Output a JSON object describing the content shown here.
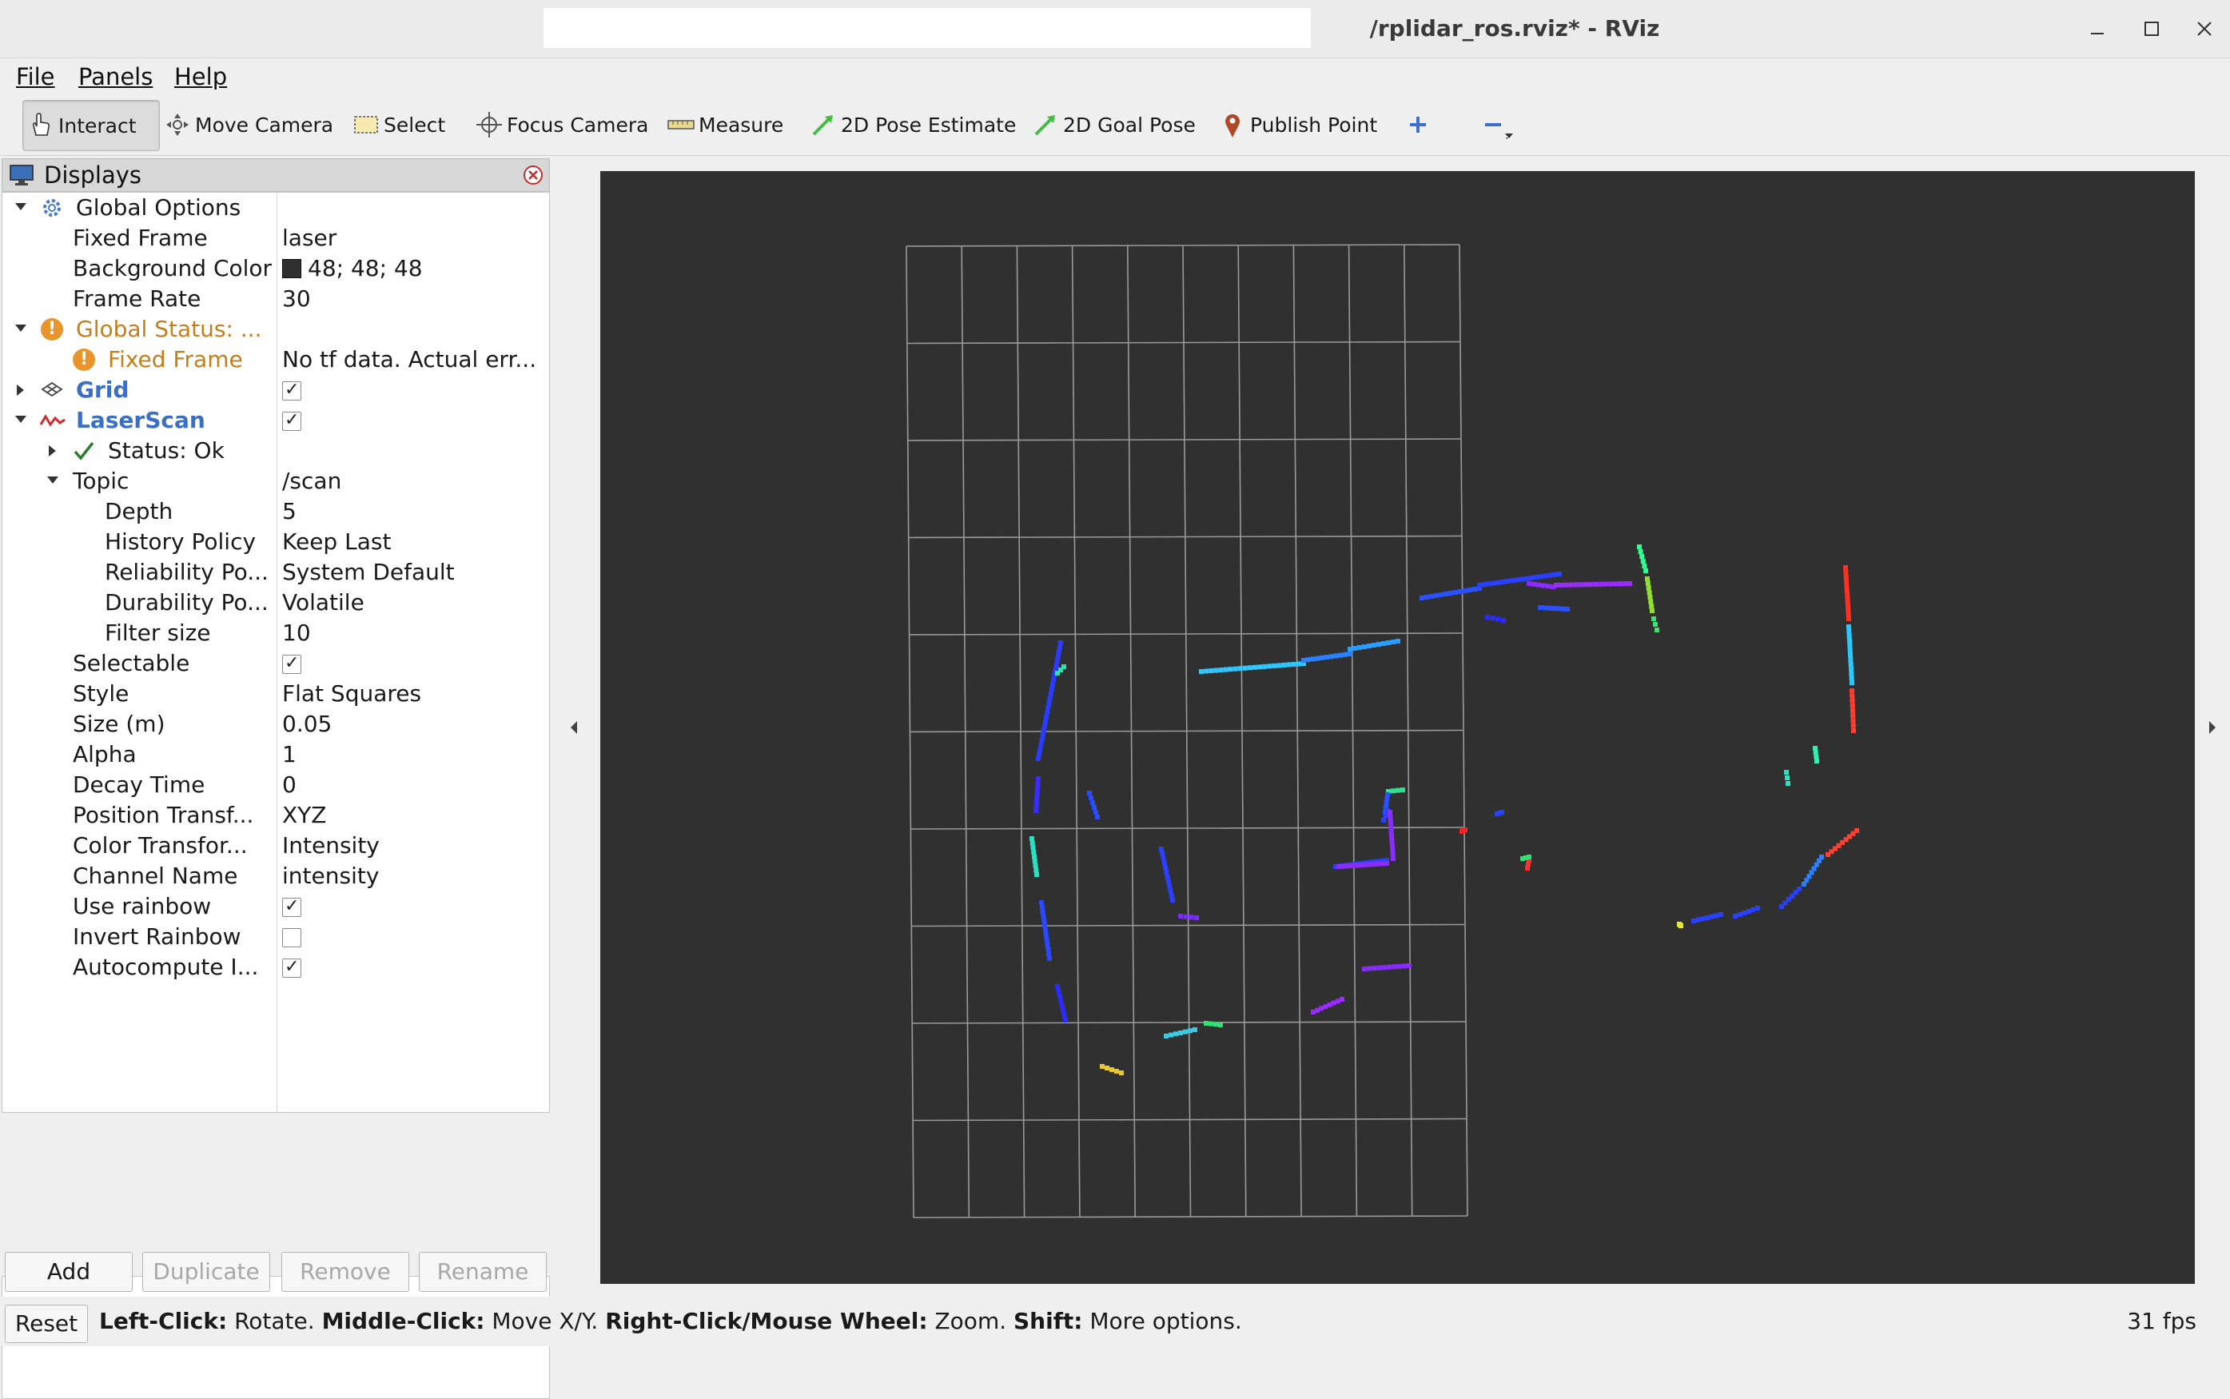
{
  "window": {
    "title": "/rplidar_ros.rviz* - RViz"
  },
  "menu": {
    "file": "File",
    "panels": "Panels",
    "help": "Help"
  },
  "toolbar": {
    "interact": "Interact",
    "move_camera": "Move Camera",
    "select": "Select",
    "focus_camera": "Focus Camera",
    "measure": "Measure",
    "pose_estimate": "2D Pose Estimate",
    "goal_pose": "2D Goal Pose",
    "publish_point": "Publish Point"
  },
  "displays": {
    "title": "Displays",
    "global_options": "Global Options",
    "fixed_frame_label": "Fixed Frame",
    "fixed_frame_value": "laser",
    "bg_color_label": "Background Color",
    "bg_color_value": "48; 48; 48",
    "bg_color_hex": "#303030",
    "frame_rate_label": "Frame Rate",
    "frame_rate_value": "30",
    "global_status": "Global Status: ...",
    "status_fixed_frame": "Fixed Frame",
    "status_fixed_frame_value": "No tf data.  Actual err...",
    "grid": "Grid",
    "grid_enabled": true,
    "laserscan": "LaserScan",
    "laserscan_enabled": true,
    "status_ok": "Status: Ok",
    "topic_label": "Topic",
    "topic_value": "/scan",
    "depth_label": "Depth",
    "depth_value": "5",
    "history_label": "History Policy",
    "history_value": "Keep Last",
    "reliability_label": "Reliability Po...",
    "reliability_value": "System Default",
    "durability_label": "Durability Po...",
    "durability_value": "Volatile",
    "filter_label": "Filter size",
    "filter_value": "10",
    "selectable_label": "Selectable",
    "selectable_value": true,
    "style_label": "Style",
    "style_value": "Flat Squares",
    "size_label": "Size (m)",
    "size_value": "0.05",
    "alpha_label": "Alpha",
    "alpha_value": "1",
    "decay_label": "Decay Time",
    "decay_value": "0",
    "position_label": "Position Transf...",
    "position_value": "XYZ",
    "color_label": "Color Transfor...",
    "color_value": "Intensity",
    "channel_label": "Channel Name",
    "channel_value": "intensity",
    "rainbow_label": "Use rainbow",
    "rainbow_value": true,
    "invert_label": "Invert Rainbow",
    "invert_value": false,
    "autocompute_label": "Autocompute I...",
    "autocompute_value": true
  },
  "panel_buttons": {
    "add": "Add",
    "duplicate": "Duplicate",
    "remove": "Remove",
    "rename": "Rename"
  },
  "status": {
    "reset": "Reset",
    "hint_left_key": "Left-Click:",
    "hint_left": " Rotate. ",
    "hint_middle_key": "Middle-Click:",
    "hint_middle": " Move X/Y. ",
    "hint_right_key": "Right-Click/Mouse Wheel:",
    "hint_right": " Zoom. ",
    "hint_shift_key": "Shift:",
    "hint_shift": " More options.",
    "fps": "31 fps"
  }
}
